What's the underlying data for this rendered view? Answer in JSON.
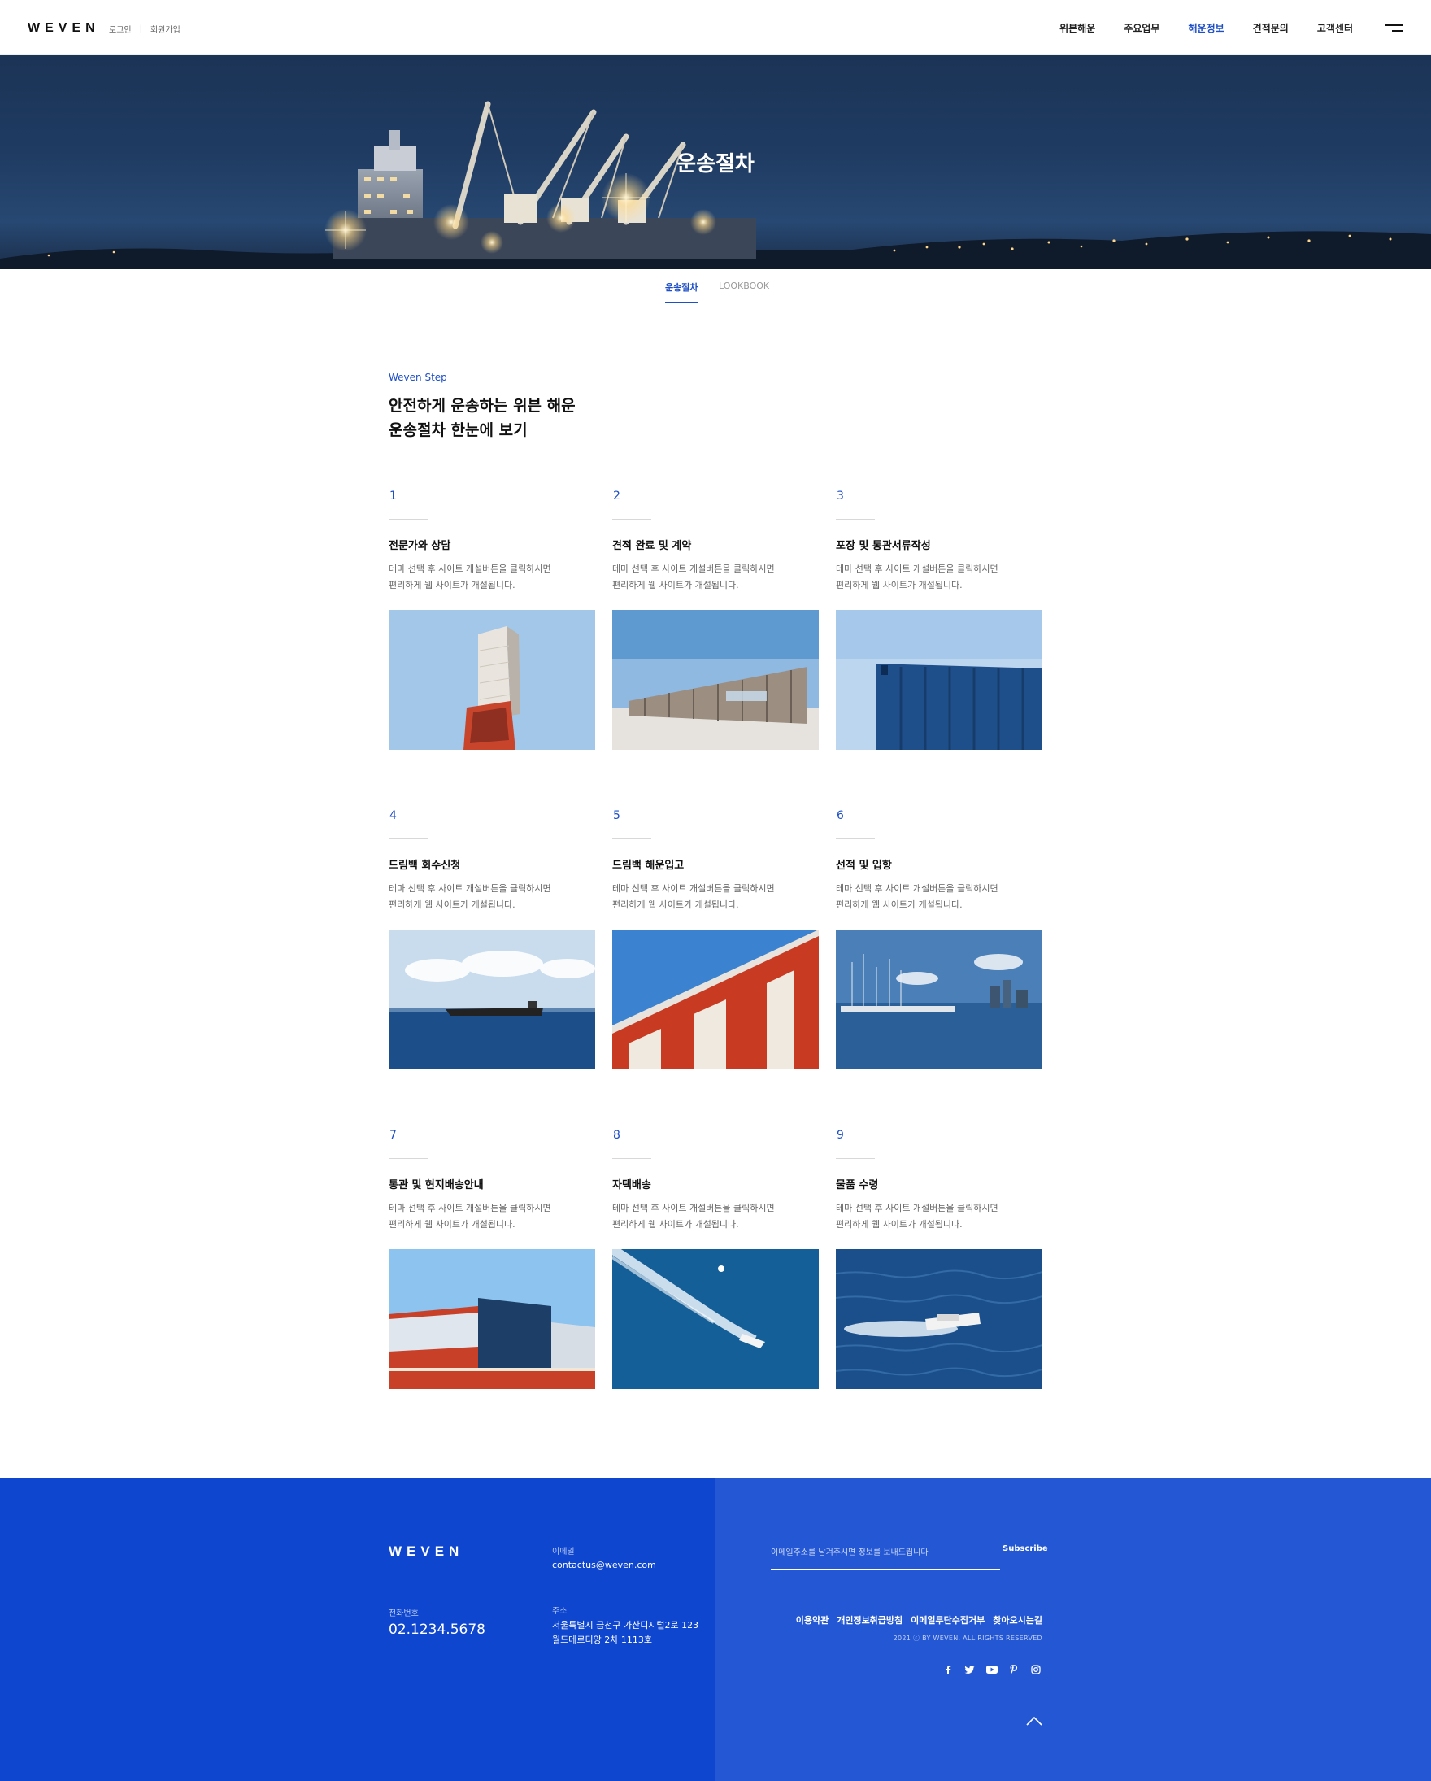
{
  "header": {
    "logo": "WEVEN",
    "login": "로그인",
    "signup": "회원가입",
    "nav": [
      "위븐해운",
      "주요업무",
      "해운정보",
      "견적문의",
      "고객센터"
    ],
    "active_nav_index": 2
  },
  "hero": {
    "title": "운송절차"
  },
  "subtabs": {
    "active": "운송절차",
    "other": "LOOKBOOK"
  },
  "intro": {
    "eyebrow": "Weven Step",
    "headline_line1": "안전하게 운송하는 위븐 해운",
    "headline_line2": "운송절차 한눈에 보기"
  },
  "steps": [
    {
      "num": "1",
      "title": "전문가와 상담",
      "desc_line1": "테마 선택 후 사이트 개설버튼을 클릭하시면",
      "desc_line2": "편리하게 웹 사이트가 개설됩니다.",
      "image": "crane-tower"
    },
    {
      "num": "2",
      "title": "견적 완료 및 계약",
      "desc_line1": "테마 선택 후 사이트 개설버튼을 클릭하시면",
      "desc_line2": "편리하게 웹 사이트가 개설됩니다.",
      "image": "building-facade"
    },
    {
      "num": "3",
      "title": "포장 및 통관서류작성",
      "desc_line1": "테마 선택 후 사이트 개설버튼을 클릭하시면",
      "desc_line2": "편리하게 웹 사이트가 개설됩니다.",
      "image": "blue-container"
    },
    {
      "num": "4",
      "title": "드림백 회수신청",
      "desc_line1": "테마 선택 후 사이트 개설버튼을 클릭하시면",
      "desc_line2": "편리하게 웹 사이트가 개설됩니다.",
      "image": "ship-at-sea"
    },
    {
      "num": "5",
      "title": "드림백 해운입고",
      "desc_line1": "테마 선택 후 사이트 개설버튼을 클릭하시면",
      "desc_line2": "편리하게 웹 사이트가 개설됩니다.",
      "image": "red-warehouse"
    },
    {
      "num": "6",
      "title": "선적 및 입항",
      "desc_line1": "테마 선택 후 사이트 개설버튼을 클릭하시면",
      "desc_line2": "편리하게 웹 사이트가 개설됩니다.",
      "image": "marina"
    },
    {
      "num": "7",
      "title": "통관 및 현지배송안내",
      "desc_line1": "테마 선택 후 사이트 개설버튼을 클릭하시면",
      "desc_line2": "편리하게 웹 사이트가 개설됩니다.",
      "image": "container-building"
    },
    {
      "num": "8",
      "title": "자택배송",
      "desc_line1": "테마 선택 후 사이트 개설버튼을 클릭하시면",
      "desc_line2": "편리하게 웹 사이트가 개설됩니다.",
      "image": "speedboat-wake"
    },
    {
      "num": "9",
      "title": "물품 수령",
      "desc_line1": "테마 선택 후 사이트 개설버튼을 클릭하시면",
      "desc_line2": "편리하게 웹 사이트가 개설됩니다.",
      "image": "boat-waves"
    }
  ],
  "footer": {
    "logo": "WEVEN",
    "email_label": "이메일",
    "email": "contactus@weven.com",
    "phone_label": "전화번호",
    "phone": "02.1234.5678",
    "address_label": "주소",
    "address_line1": "서울특별시 금천구 가산디지털2로 123",
    "address_line2": "월드메르디앙 2차 1113호",
    "subscribe_placeholder": "이메일주소를 남겨주시면 정보를 보내드립니다",
    "subscribe_button": "Subscribe",
    "links": [
      "이용약관",
      "개인정보취급방침",
      "이메일무단수집거부",
      "찾아오시는길"
    ],
    "copyright": "2021 ⓒ BY WEVEN. ALL RIGHTS RESERVED",
    "social_icons": [
      "facebook-icon",
      "twitter-icon",
      "youtube-icon",
      "pinterest-icon",
      "instagram-icon"
    ]
  },
  "colors": {
    "accent": "#1e4fc7",
    "footer_left": "#0e46cf",
    "footer_right": "#2457d3"
  }
}
